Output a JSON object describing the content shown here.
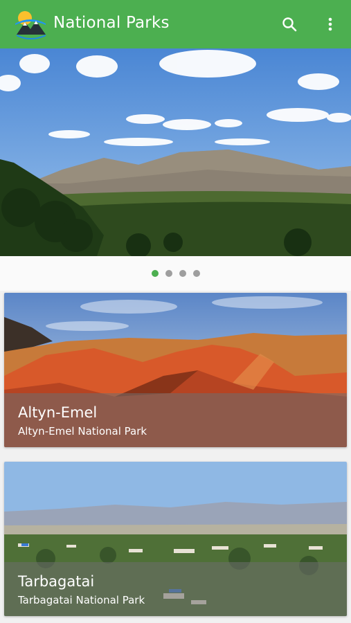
{
  "app_bar": {
    "title": "National Parks",
    "color": "#4caf50",
    "logo_icon": "mountain-sun-logo",
    "actions": [
      {
        "icon": "search-icon"
      },
      {
        "icon": "more-vert-icon"
      }
    ]
  },
  "carousel": {
    "page_count": 4,
    "active_page": 1
  },
  "parks": [
    {
      "name": "Altyn-Emel",
      "full_name": "Altyn-Emel National Park"
    },
    {
      "name": "Tarbagatai",
      "full_name": "Tarbagatai National Park"
    }
  ]
}
